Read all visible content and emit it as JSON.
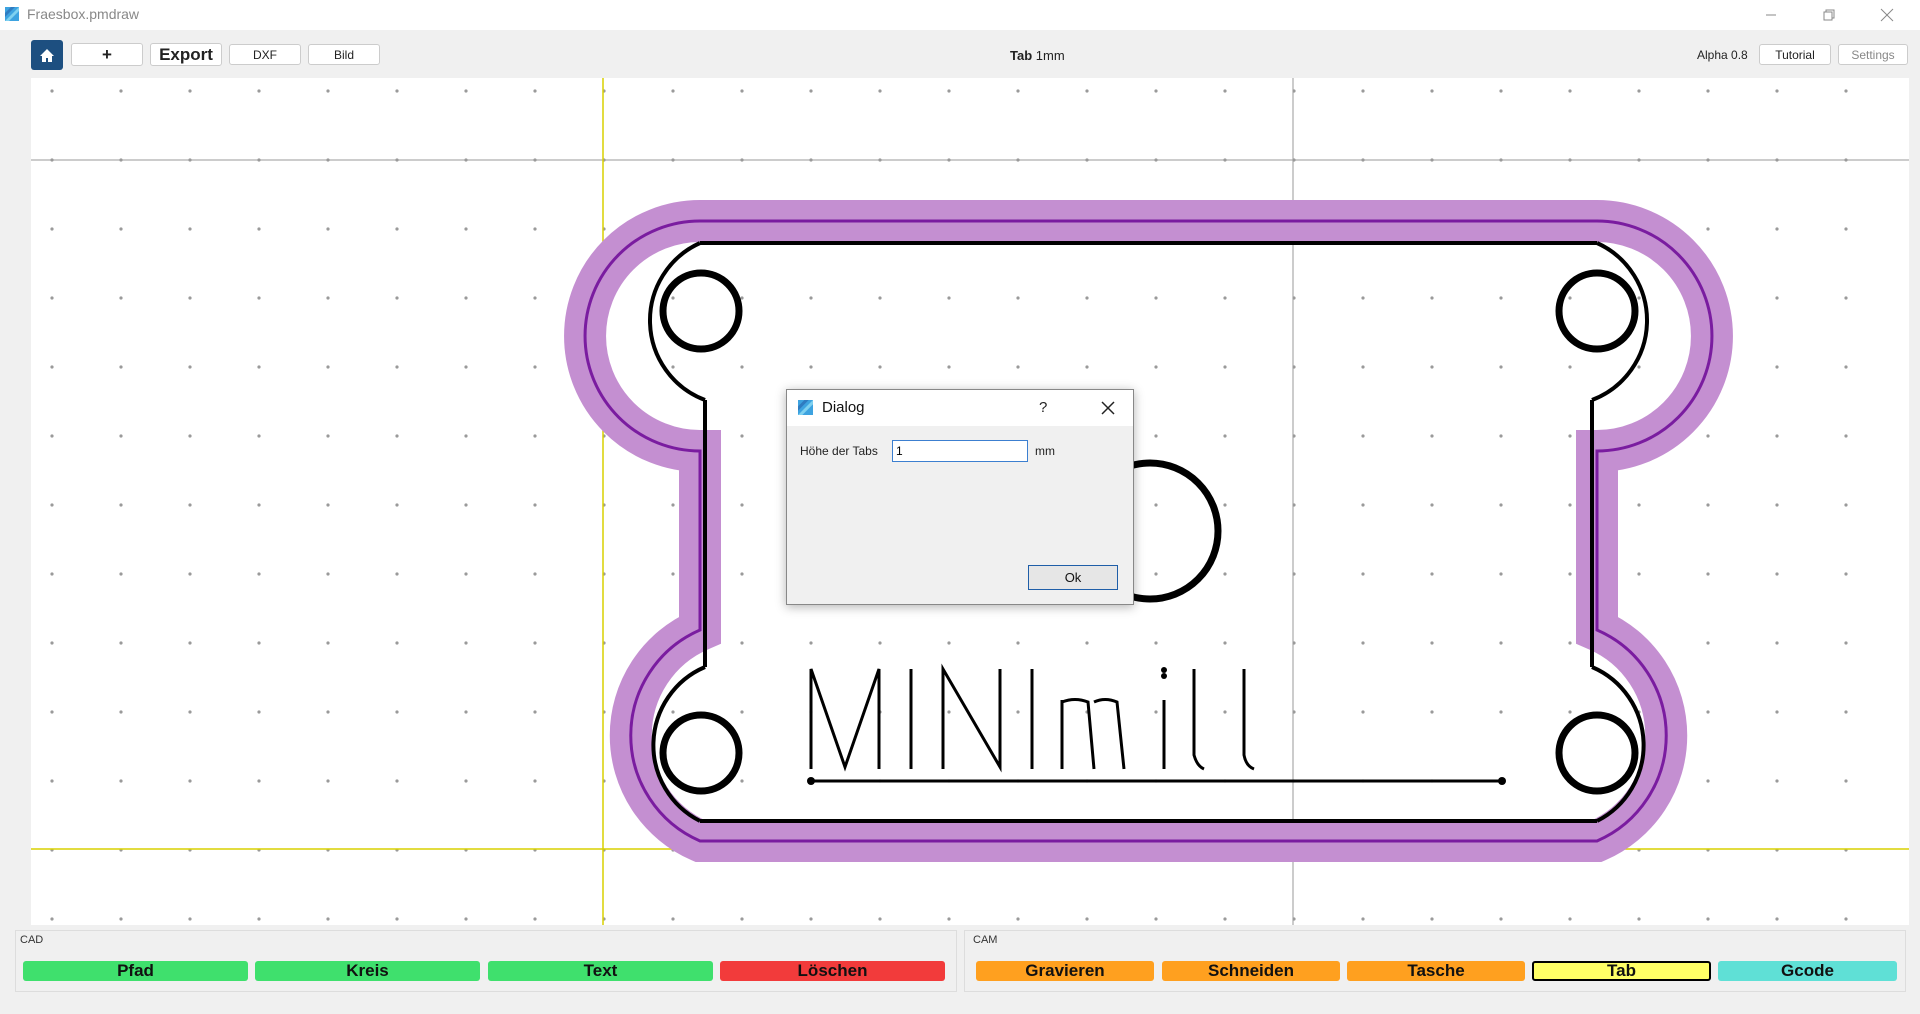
{
  "window": {
    "title": "Fraesbox.pmdraw"
  },
  "toolbar": {
    "add_label": "+",
    "export_label": "Export",
    "dxf_label": "DXF",
    "bild_label": "Bild",
    "tool_name": "Tab",
    "tool_value": "1mm",
    "version": "Alpha 0.8",
    "tutorial_label": "Tutorial",
    "settings_label": "Settings"
  },
  "canvas": {
    "text": "MINImill"
  },
  "dialog": {
    "title": "Dialog",
    "help": "?",
    "field_label": "Höhe der Tabs",
    "field_value": "1",
    "unit": "mm",
    "ok_label": "Ok"
  },
  "cad": {
    "label": "CAD",
    "buttons": [
      {
        "label": "Pfad",
        "color": "#3fe06d"
      },
      {
        "label": "Kreis",
        "color": "#3fe06d"
      },
      {
        "label": "Text",
        "color": "#3fe06d"
      },
      {
        "label": "Löschen",
        "color": "#f23b3b"
      }
    ]
  },
  "cam": {
    "label": "CAM",
    "buttons": [
      {
        "label": "Gravieren",
        "color": "#ffa01f"
      },
      {
        "label": "Schneiden",
        "color": "#ffa01f"
      },
      {
        "label": "Tasche",
        "color": "#ffa01f"
      },
      {
        "label": "Tab",
        "color": "#ffff66"
      },
      {
        "label": "Gcode",
        "color": "#5fe0d6"
      }
    ]
  },
  "colors": {
    "accent": "#1d4f80",
    "toolpath": "#c48fd1",
    "toolpath_line": "#7a1ca0",
    "guide": "#d8d000"
  }
}
